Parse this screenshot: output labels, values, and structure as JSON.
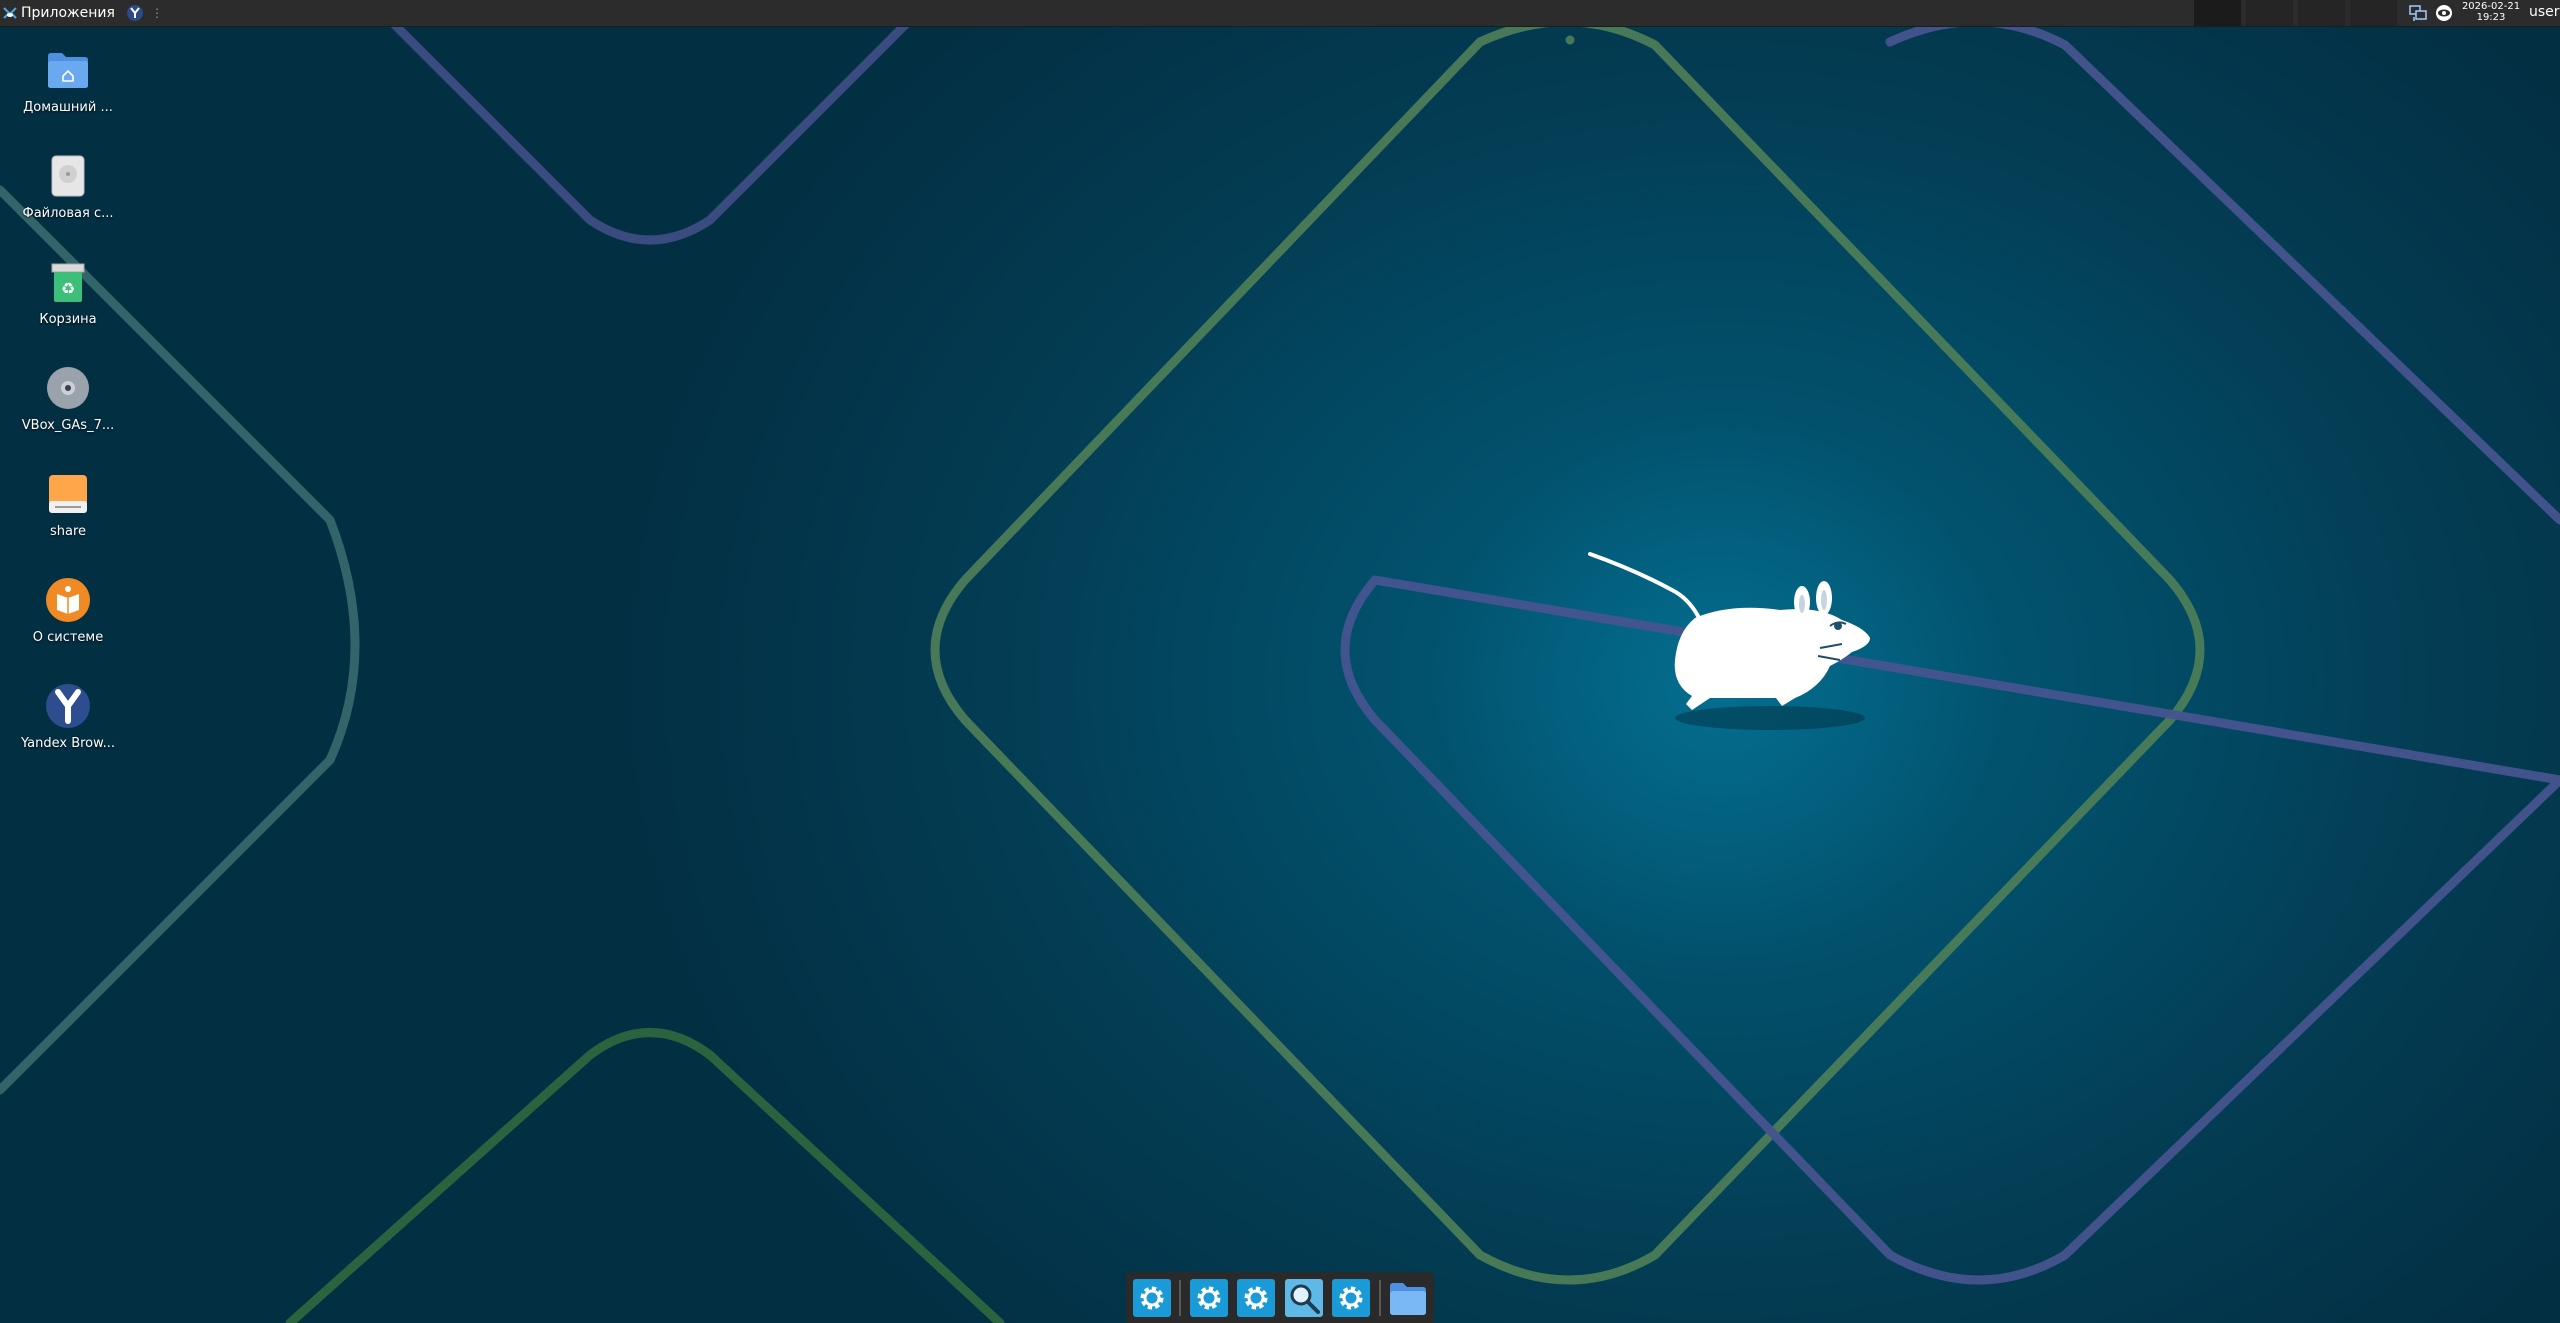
{
  "top_panel": {
    "apps_menu_label": "Приложения",
    "launcher_icon": "yandex-browser-icon",
    "separator_glyph": "⋮",
    "workspaces": [
      "1",
      "2",
      "3",
      "4"
    ],
    "tray_icons": [
      "network-icon",
      "eye-icon"
    ],
    "clock": {
      "date": "2026-02-21",
      "time": "19:23"
    },
    "user": "user"
  },
  "desktop": {
    "icons": [
      {
        "label": "Домашний ...",
        "icon": "home-folder-icon"
      },
      {
        "label": "Файловая с...",
        "icon": "filesystem-drive-icon"
      },
      {
        "label": "Корзина",
        "icon": "trash-icon"
      },
      {
        "label": "VBox_GAs_7...",
        "icon": "optical-disc-icon"
      },
      {
        "label": "share",
        "icon": "network-drive-icon"
      },
      {
        "label": "О системе",
        "icon": "about-system-icon"
      },
      {
        "label": "Yandex Brow...",
        "icon": "yandex-browser-icon"
      }
    ]
  },
  "dock": {
    "items": [
      {
        "icon": "settings-gear-icon"
      },
      {
        "icon": "settings-gear-icon"
      },
      {
        "icon": "settings-gear-icon"
      },
      {
        "icon": "search-magnifier-icon"
      },
      {
        "icon": "settings-gear-icon"
      },
      {
        "icon": "folder-icon"
      }
    ]
  },
  "colors": {
    "panel": "#2c2c2c",
    "wallpaper_center": "#00607f",
    "wallpaper_edge": "#032f43",
    "line_green": "#4f7f58",
    "line_blue": "#46548f",
    "dock_icon_bg": "#1a9bd7"
  }
}
